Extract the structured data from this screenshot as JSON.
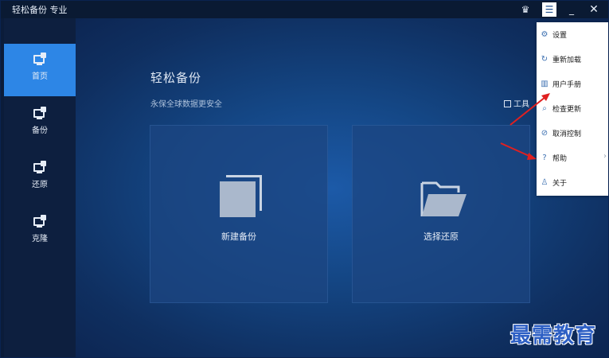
{
  "app": {
    "title": "轻松备份 专业"
  },
  "titlebar": {
    "vip_icon": "crown-icon",
    "menu_icon": "menu-icon",
    "minimize_label": "_",
    "close_label": "✕"
  },
  "sidebar": {
    "items": [
      {
        "label": "首页",
        "icon": "home-monitor-icon",
        "active": true
      },
      {
        "label": "备份",
        "icon": "backup-monitor-icon",
        "active": false
      },
      {
        "label": "还原",
        "icon": "restore-monitor-icon",
        "active": false
      },
      {
        "label": "克隆",
        "icon": "clone-monitor-icon",
        "active": false
      }
    ]
  },
  "main": {
    "title": "轻松备份",
    "subtitle": "永保全球数据更安全",
    "tools_label": "工具",
    "cards": [
      {
        "label": "新建备份",
        "icon": "copy-icon"
      },
      {
        "label": "选择还原",
        "icon": "folder-open-icon"
      }
    ]
  },
  "menu": {
    "items": [
      {
        "label": "设置",
        "icon": "gear-icon",
        "glyph": "⚙"
      },
      {
        "label": "重新加载",
        "icon": "reload-icon",
        "glyph": "↻"
      },
      {
        "label": "用户手册",
        "icon": "manual-icon",
        "glyph": "▥"
      },
      {
        "label": "检查更新",
        "icon": "search-icon",
        "glyph": "⌕"
      },
      {
        "label": "取消控制",
        "icon": "cancel-icon",
        "glyph": "⊘"
      },
      {
        "label": "帮助",
        "icon": "help-icon",
        "glyph": "?",
        "has_submenu": true
      },
      {
        "label": "关于",
        "icon": "user-icon",
        "glyph": "♙"
      }
    ]
  },
  "watermark": {
    "text": "最需教育"
  },
  "colors": {
    "accent": "#2d86e6",
    "annotation": "#e02020",
    "watermark": "#2d5fc4"
  }
}
